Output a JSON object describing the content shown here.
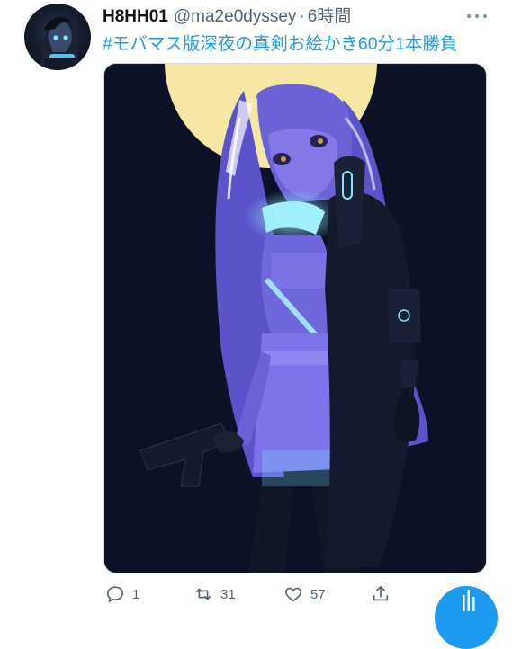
{
  "tweet": {
    "display_name": "H8HH01",
    "handle": "@ma2e0dyssey",
    "separator": "·",
    "time": "6時間",
    "hashtag": "#モバマス版深夜の真剣お絵かき60分1本勝負",
    "more_icon": "more-dots-icon",
    "avatar_alt": "user-avatar-illustration"
  },
  "media": {
    "kind": "illustration",
    "colors": {
      "background": "#0c1126",
      "moon": "#f6e7a4",
      "hair": "#6a62d6",
      "glow": "#7fe6ff",
      "coat": "#141a2b"
    }
  },
  "actions": {
    "reply": {
      "icon": "reply-icon",
      "count": "1"
    },
    "retweet": {
      "icon": "retweet-icon",
      "count": "31"
    },
    "like": {
      "icon": "heart-icon",
      "count": "57"
    },
    "share": {
      "icon": "share-icon"
    }
  },
  "colors": {
    "accent": "#1d9bf0",
    "text_primary": "#0f1419",
    "text_secondary": "#536471"
  }
}
